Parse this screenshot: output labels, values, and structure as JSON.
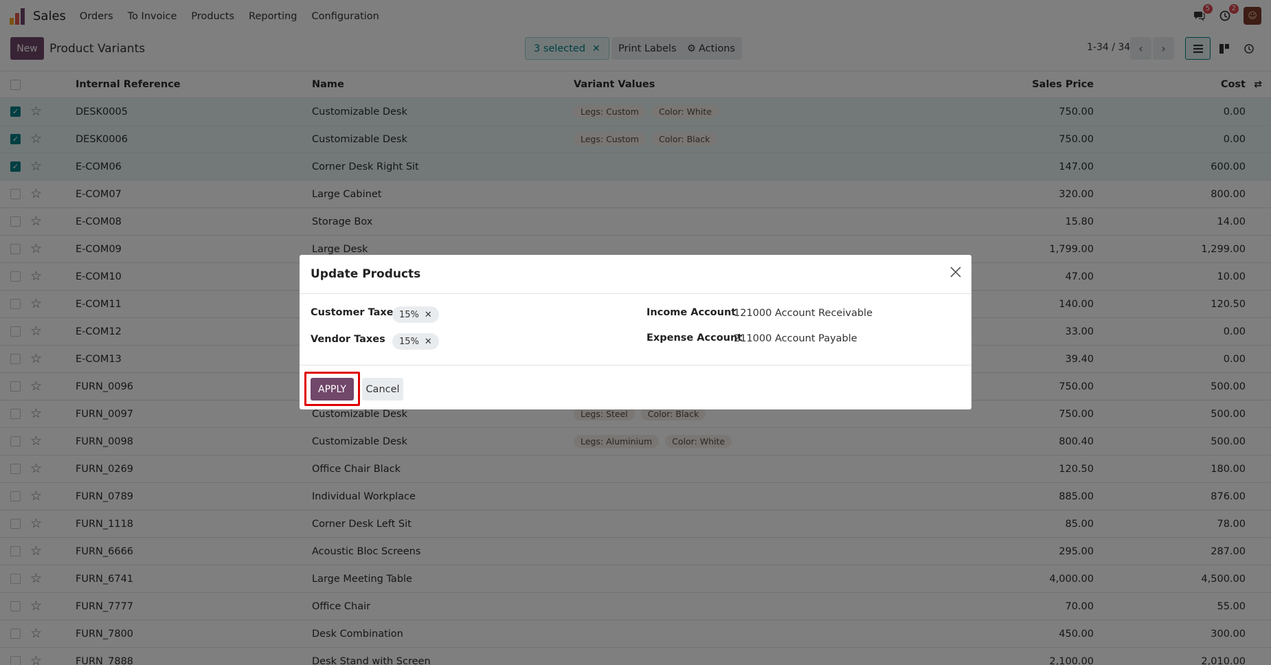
{
  "nav": {
    "app_name": "Sales",
    "menu": [
      "Orders",
      "To Invoice",
      "Products",
      "Reporting",
      "Configuration"
    ],
    "messages_badge": "5",
    "activity_badge": "2"
  },
  "control_panel": {
    "new_label": "New",
    "title": "Product Variants",
    "selected_label": "3 selected",
    "print_labels": "Print Labels",
    "actions": "Actions",
    "pager": "1-34 / 34"
  },
  "table": {
    "headers": {
      "ref": "Internal Reference",
      "name": "Name",
      "variants": "Variant Values",
      "price": "Sales Price",
      "cost": "Cost"
    },
    "rows": [
      {
        "ref": "DESK0005",
        "name": "Customizable Desk",
        "variants": [
          "Legs: Custom",
          "Color: White"
        ],
        "price": "750.00",
        "cost": "0.00",
        "selected": true
      },
      {
        "ref": "DESK0006",
        "name": "Customizable Desk",
        "variants": [
          "Legs: Custom",
          "Color: Black"
        ],
        "price": "750.00",
        "cost": "0.00",
        "selected": true
      },
      {
        "ref": "E-COM06",
        "name": "Corner Desk Right Sit",
        "variants": [],
        "price": "147.00",
        "cost": "600.00",
        "selected": true
      },
      {
        "ref": "E-COM07",
        "name": "Large Cabinet",
        "variants": [],
        "price": "320.00",
        "cost": "800.00",
        "selected": false
      },
      {
        "ref": "E-COM08",
        "name": "Storage Box",
        "variants": [],
        "price": "15.80",
        "cost": "14.00",
        "selected": false
      },
      {
        "ref": "E-COM09",
        "name": "Large Desk",
        "variants": [],
        "price": "1,799.00",
        "cost": "1,299.00",
        "selected": false
      },
      {
        "ref": "E-COM10",
        "name": "",
        "variants": [],
        "price": "47.00",
        "cost": "10.00",
        "selected": false
      },
      {
        "ref": "E-COM11",
        "name": "",
        "variants": [],
        "price": "140.00",
        "cost": "120.50",
        "selected": false
      },
      {
        "ref": "E-COM12",
        "name": "",
        "variants": [],
        "price": "33.00",
        "cost": "0.00",
        "selected": false
      },
      {
        "ref": "E-COM13",
        "name": "",
        "variants": [],
        "price": "39.40",
        "cost": "0.00",
        "selected": false
      },
      {
        "ref": "FURN_0096",
        "name": "",
        "variants": [],
        "price": "750.00",
        "cost": "500.00",
        "selected": false
      },
      {
        "ref": "FURN_0097",
        "name": "Customizable Desk",
        "variants": [
          "Legs: Steel",
          "Color: Black"
        ],
        "price": "750.00",
        "cost": "500.00",
        "selected": false
      },
      {
        "ref": "FURN_0098",
        "name": "Customizable Desk",
        "variants": [
          "Legs: Aluminium",
          "Color: White"
        ],
        "price": "800.40",
        "cost": "500.00",
        "selected": false
      },
      {
        "ref": "FURN_0269",
        "name": "Office Chair Black",
        "variants": [],
        "price": "120.50",
        "cost": "180.00",
        "selected": false
      },
      {
        "ref": "FURN_0789",
        "name": "Individual Workplace",
        "variants": [],
        "price": "885.00",
        "cost": "876.00",
        "selected": false
      },
      {
        "ref": "FURN_1118",
        "name": "Corner Desk Left Sit",
        "variants": [],
        "price": "85.00",
        "cost": "78.00",
        "selected": false
      },
      {
        "ref": "FURN_6666",
        "name": "Acoustic Bloc Screens",
        "variants": [],
        "price": "295.00",
        "cost": "287.00",
        "selected": false
      },
      {
        "ref": "FURN_6741",
        "name": "Large Meeting Table",
        "variants": [],
        "price": "4,000.00",
        "cost": "4,500.00",
        "selected": false
      },
      {
        "ref": "FURN_7777",
        "name": "Office Chair",
        "variants": [],
        "price": "70.00",
        "cost": "55.00",
        "selected": false
      },
      {
        "ref": "FURN_7800",
        "name": "Desk Combination",
        "variants": [],
        "price": "450.00",
        "cost": "300.00",
        "selected": false
      },
      {
        "ref": "FURN_7888",
        "name": "Desk Stand with Screen",
        "variants": [],
        "price": "2,100.00",
        "cost": "2,010.00",
        "selected": false
      }
    ]
  },
  "modal": {
    "title": "Update Products",
    "customer_taxes_label": "Customer Taxes",
    "customer_taxes_tag": "15%",
    "vendor_taxes_label": "Vendor Taxes",
    "vendor_taxes_tag": "15%",
    "income_account_label": "Income Account",
    "income_account_value": "121000 Account Receivable",
    "expense_account_label": "Expense Account",
    "expense_account_value": "211000 Account Payable",
    "apply_label": "APPLY",
    "cancel_label": "Cancel"
  },
  "colors": {
    "primary": "#71476a",
    "accent": "#017e84",
    "highlight": "#e00000"
  }
}
